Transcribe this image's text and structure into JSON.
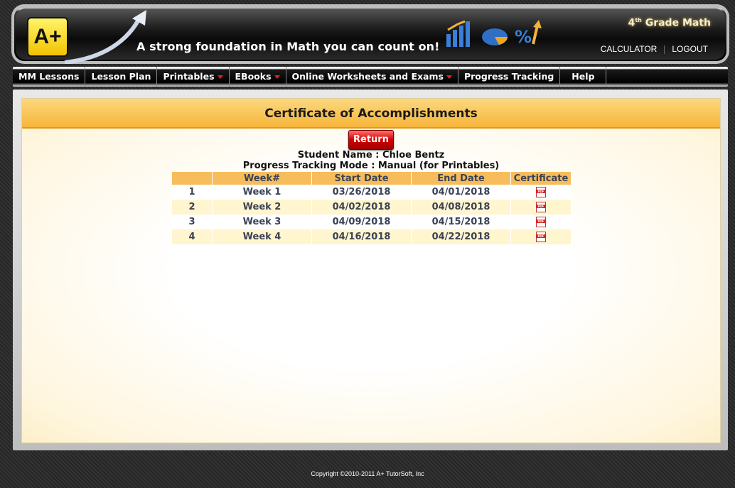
{
  "header": {
    "logo_text": "A+",
    "tagline": "A strong foundation in Math you can count on!",
    "grade_number": "4",
    "grade_suffix": "th",
    "grade_label": " Grade Math",
    "links": {
      "calculator": "CALCULATOR",
      "logout": "LOGOUT"
    }
  },
  "nav": {
    "items": [
      {
        "label": "MM Lessons",
        "dropdown": false
      },
      {
        "label": "Lesson Plan",
        "dropdown": false
      },
      {
        "label": "Printables",
        "dropdown": true
      },
      {
        "label": "EBooks",
        "dropdown": true
      },
      {
        "label": "Online Worksheets and Exams",
        "dropdown": true
      },
      {
        "label": "Progress Tracking",
        "dropdown": false
      },
      {
        "label": "Help",
        "dropdown": false
      }
    ]
  },
  "panel": {
    "title": "Certificate of Accomplishments",
    "return_label": "Return",
    "student_line": "Student Name : Chloe Bentz",
    "mode_line": "Progress Tracking Mode : Manual (for Printables)"
  },
  "table": {
    "headers": [
      "",
      "Week#",
      "Start Date",
      "End Date",
      "Certificate"
    ],
    "rows": [
      {
        "num": "1",
        "week": "Week 1",
        "start": "03/26/2018",
        "end": "04/01/2018",
        "certificate_icon": "pdf-icon"
      },
      {
        "num": "2",
        "week": "Week 2",
        "start": "04/02/2018",
        "end": "04/08/2018",
        "certificate_icon": "pdf-icon"
      },
      {
        "num": "3",
        "week": "Week 3",
        "start": "04/09/2018",
        "end": "04/15/2018",
        "certificate_icon": "pdf-icon"
      },
      {
        "num": "4",
        "week": "Week 4",
        "start": "04/16/2018",
        "end": "04/22/2018",
        "certificate_icon": "pdf-icon"
      }
    ]
  },
  "footer": {
    "copyright": "Copyright ©2010-2011 A+ TutorSoft, Inc"
  },
  "colors": {
    "panel_title_bg": "#f7b53a",
    "table_header_bg": "#f7bd5c",
    "row_alt_bg": "#fff5cf",
    "return_button": "#d00000",
    "nav_caret": "#e02424"
  }
}
